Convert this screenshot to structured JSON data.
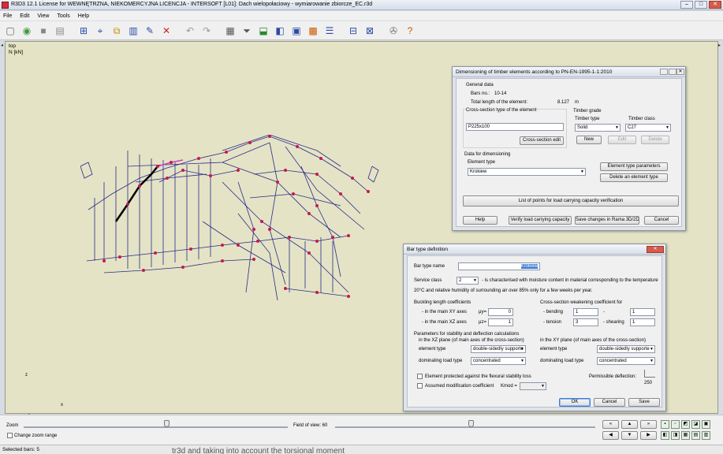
{
  "window": {
    "title": "R3D3 12.1 License for WEWNĘTRZNA, NIEKOMERCYJNA LICENCJA - INTERSOFT [L01]: Dach wielopołaciowy - wymiarowanie zbiorcze_EC.r3d",
    "minimize": "–",
    "maximize": "□",
    "close": "✕"
  },
  "menu": [
    "File",
    "Edit",
    "View",
    "Tools",
    "Help"
  ],
  "toolbar_icons": [
    "new-icon",
    "open-icon",
    "save-icon",
    "print-icon",
    "grid-icon",
    "node-icon",
    "copy-icon",
    "supports-icon",
    "edit-icon",
    "delete-icon",
    "undo-icon",
    "redo-icon",
    "table-icon",
    "filter-icon",
    "load-icon",
    "view-icon",
    "list-icon",
    "stack-icon",
    "panel-icon",
    "tree-icon",
    "tool-icon",
    "help-icon"
  ],
  "viewport": {
    "view_name": "top",
    "unit": "N [kN]",
    "axis_x": "x",
    "axis_z": "z"
  },
  "dim_dialog": {
    "title": "Dimensioning of timber elements according to PN-EN-1995-1-1:2010",
    "general_data": "General data",
    "bars_no_label": "Bars no.:",
    "bars_no_value": "10-14",
    "total_length_label": "Total length of the element:",
    "total_length_value": "8.127",
    "total_length_unit": "m",
    "cross_section_group": "Cross-section type of the element",
    "cross_section_value": "P225x100",
    "cross_section_edit": "Cross-section edit",
    "timber_grade": "Timber grade",
    "timber_type_label": "Timber type",
    "timber_type_value": "Solid",
    "timber_class_label": "Timber class",
    "timber_class_value": "C27",
    "new_btn": "New",
    "edit_btn": "Edit",
    "delete_btn": "Delete",
    "data_for_dim": "Data for dimensioning",
    "element_type_label": "Element type",
    "element_type_value": "Krokiew",
    "element_type_params": "Element type parameters",
    "delete_element_type": "Delete an element type",
    "list_points": "List of points for load carrying capacity verification",
    "help": "Help",
    "verify": "Verify load carrying capacity",
    "save_changes": "Save changes in Rama 3D/2D",
    "cancel": "Cancel"
  },
  "bar_dialog": {
    "title": "Bar type definition",
    "bar_type_name_label": "Bar type name",
    "bar_type_name_value": "Krokiew",
    "service_class_label": "Service class",
    "service_class_value": "2",
    "service_desc_1": "- is characterised with moisture content in material corresponding to the temperature",
    "service_desc_2": "20°C and relative humidity of surrounding air over 85% only for a few weeks per year.",
    "buckling_title": "Buckling length coefficients",
    "xy_axes_label": "- in the main XY axes",
    "mu_y": "μy=",
    "mu_y_value": "0",
    "xz_axes_label": "- in the main XZ axes",
    "mu_z": "μz=",
    "mu_z_value": "1",
    "weakening_title": "Cross-section weakening coefficient for",
    "bending_label": "- bending",
    "bending_value": "1",
    "dash": "-",
    "bending_value2": "1",
    "tension_label": "- tension",
    "tension_value": "3",
    "shearing_label": "- shearing",
    "shearing_value": "1",
    "stability_title": "Parameters for stability and deflection calculations",
    "xz_plane_label": "in the XZ plane (of main axes of the cross-section)",
    "xy_plane_label": "in the XY plane (of main axes of the cross-section)",
    "element_type_label": "element type",
    "element_type_xz": "double-sidedly supporte",
    "element_type_xy": "double-sidedly supporte",
    "dominating_load_label": "dominating load type",
    "load_xz": "concentrated",
    "load_xy": "concentrated",
    "protected_label": "Element protected against the flexural stability loss",
    "assumed_mod_label": "Assumed modification coefficient",
    "kmod_label": "Kmod =",
    "kmod_value": "",
    "permissible_deflection_label": "Permissible deflection:",
    "permissible_deflection_value": "250",
    "ok": "OK",
    "cancel": "Cancel",
    "save": "Save"
  },
  "bottom": {
    "zoom_label": "Zoom",
    "fov_label": "Field of view: 60",
    "change_zoom_range": "Change zoom range",
    "zoom_level": 0.54,
    "fov_level": 0.52
  },
  "status": {
    "selected": "Selected bars: 5"
  },
  "background_text": "tr3d and taking into account the torsional moment"
}
